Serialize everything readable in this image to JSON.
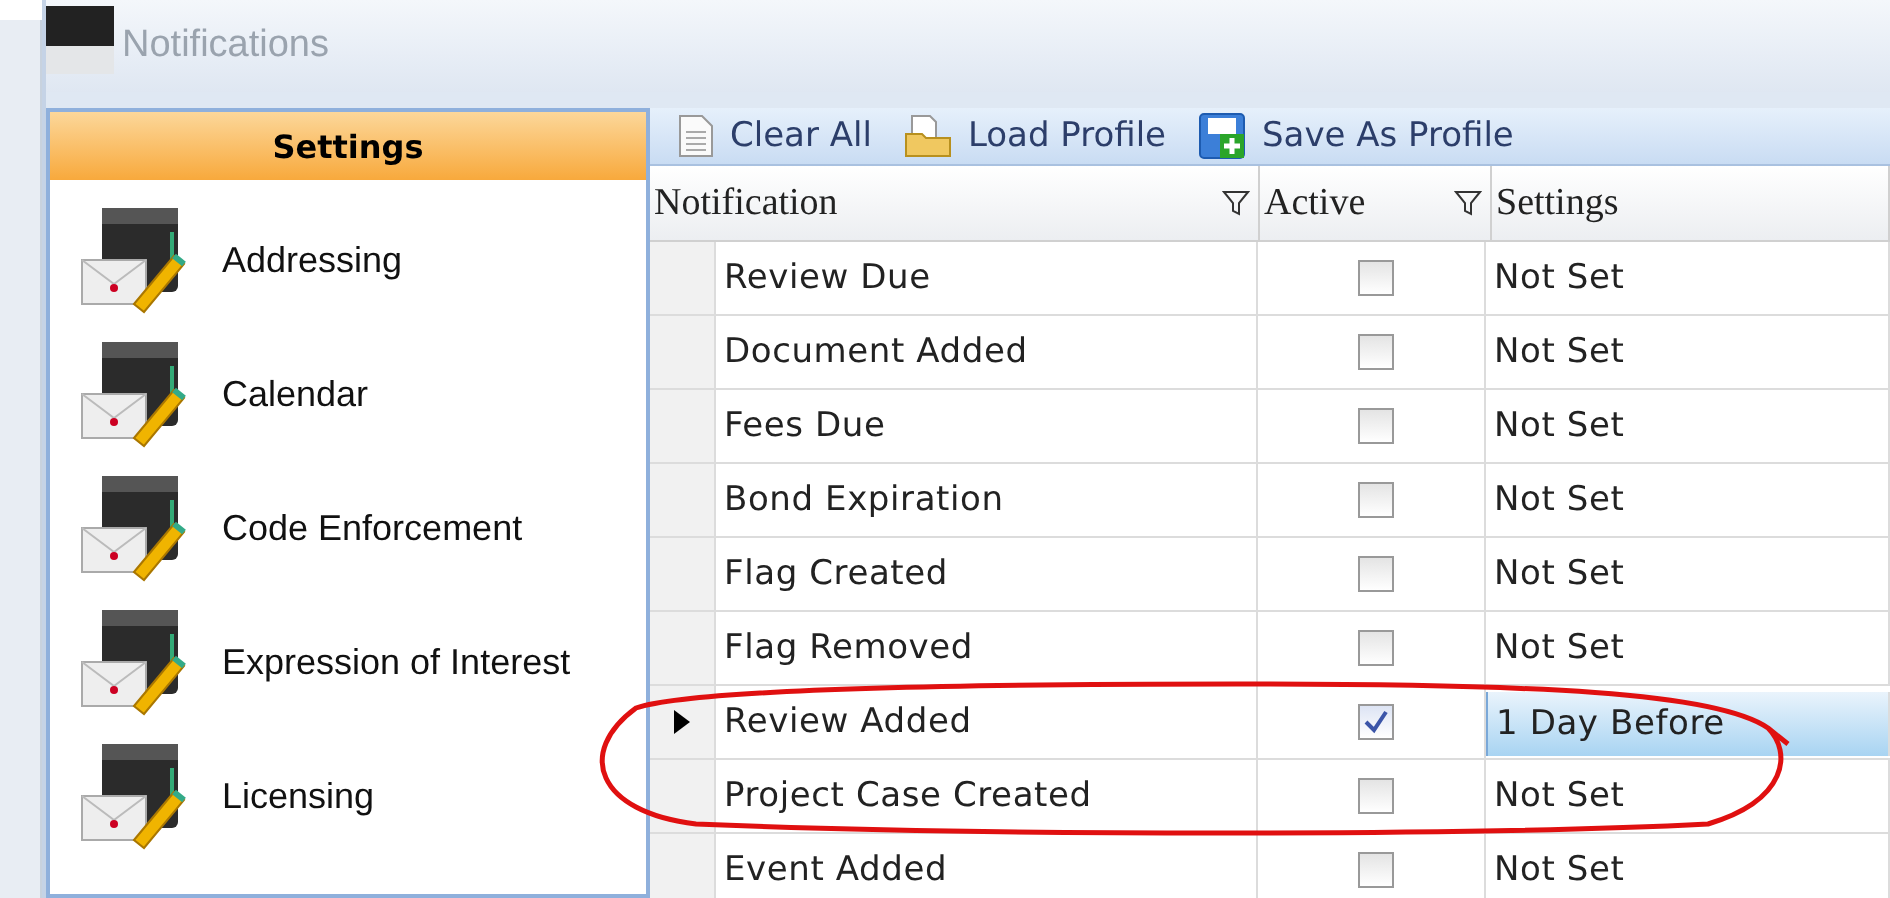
{
  "window": {
    "title": "Notifications"
  },
  "sidebar": {
    "header": "Settings",
    "items": [
      {
        "label": "Addressing"
      },
      {
        "label": "Calendar"
      },
      {
        "label": "Code Enforcement"
      },
      {
        "label": "Expression of Interest"
      },
      {
        "label": "Licensing"
      }
    ]
  },
  "toolbar": [
    {
      "label": "Clear All",
      "kind": "page"
    },
    {
      "label": "Load Profile",
      "kind": "folder"
    },
    {
      "label": "Save As Profile",
      "kind": "save"
    }
  ],
  "table": {
    "columns": [
      {
        "label": "Notification",
        "filter": true
      },
      {
        "label": "Active",
        "filter": true
      },
      {
        "label": "Settings",
        "filter": false
      }
    ],
    "rows": [
      {
        "name": "Review Due",
        "active": false,
        "setting": "Not Set",
        "selected": false
      },
      {
        "name": "Document Added",
        "active": false,
        "setting": "Not Set",
        "selected": false
      },
      {
        "name": "Fees Due",
        "active": false,
        "setting": "Not Set",
        "selected": false
      },
      {
        "name": "Bond Expiration",
        "active": false,
        "setting": "Not Set",
        "selected": false
      },
      {
        "name": "Flag Created",
        "active": false,
        "setting": "Not Set",
        "selected": false
      },
      {
        "name": "Flag Removed",
        "active": false,
        "setting": "Not Set",
        "selected": false
      },
      {
        "name": "Review Added",
        "active": true,
        "setting": "1 Day Before",
        "selected": true
      },
      {
        "name": "Project Case Created",
        "active": false,
        "setting": "Not Set",
        "selected": false
      },
      {
        "name": "Event Added",
        "active": false,
        "setting": "Not Set",
        "selected": false
      }
    ]
  }
}
